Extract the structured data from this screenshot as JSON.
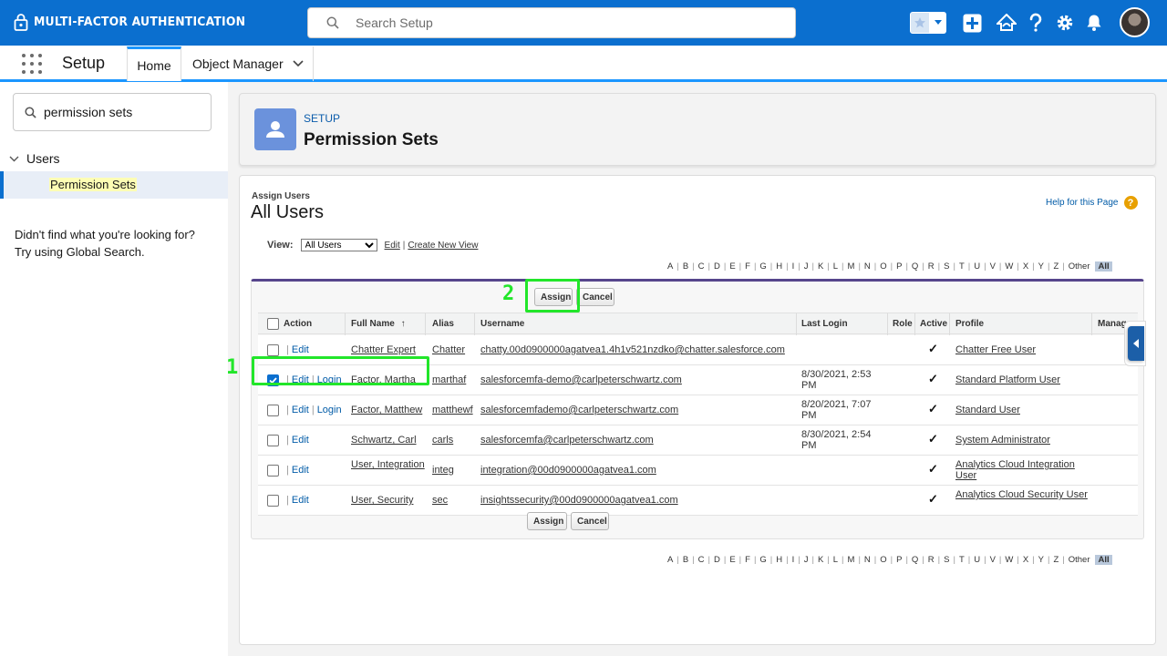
{
  "header": {
    "brand": "MULTI-FACTOR AUTHENTICATION",
    "search_placeholder": "Search Setup"
  },
  "nav": {
    "app_name": "Setup",
    "tabs": [
      {
        "label": "Home"
      },
      {
        "label": "Object Manager"
      }
    ]
  },
  "sidebar": {
    "search_value": "permission sets",
    "group": "Users",
    "selected_item": "Permission Sets",
    "help_line1": "Didn't find what you're looking for?",
    "help_line2": "Try using Global Search."
  },
  "page_header": {
    "breadcrumb": "SETUP",
    "title": "Permission Sets"
  },
  "content": {
    "subtitle": "Assign Users",
    "title": "All Users",
    "help_link": "Help for this Page",
    "view_label": "View:",
    "view_selected": "All Users",
    "view_edit": "Edit",
    "view_create": "Create New View",
    "alphabet": [
      "A",
      "B",
      "C",
      "D",
      "E",
      "F",
      "G",
      "H",
      "I",
      "J",
      "K",
      "L",
      "M",
      "N",
      "O",
      "P",
      "Q",
      "R",
      "S",
      "T",
      "U",
      "V",
      "W",
      "X",
      "Y",
      "Z",
      "Other",
      "All"
    ],
    "assign_label": "Assign",
    "cancel_label": "Cancel",
    "columns": [
      "Action",
      "Full Name",
      "Alias",
      "Username",
      "Last Login",
      "Role",
      "Active",
      "Profile",
      "Manager"
    ],
    "sort_indicator": "↑",
    "rows": [
      {
        "checked": false,
        "actions": "Edit",
        "login": "",
        "name": "Chatter Expert",
        "alias": "Chatter",
        "username": "chatty.00d0900000agatvea1.4h1v521nzdko@chatter.salesforce.com",
        "last_login": "",
        "active": true,
        "profile": "Chatter Free User"
      },
      {
        "checked": true,
        "actions": "Edit",
        "login": "Login",
        "name": "Factor, Martha",
        "alias": "marthaf",
        "username": "salesforcemfa-demo@carlpeterschwartz.com",
        "last_login": "8/30/2021, 2:53 PM",
        "active": true,
        "profile": "Standard Platform User"
      },
      {
        "checked": false,
        "actions": "Edit",
        "login": "Login",
        "name": "Factor, Matthew",
        "alias": "matthewf",
        "username": "salesforcemfademo@carlpeterschwartz.com",
        "last_login": "8/20/2021, 7:07 PM",
        "active": true,
        "profile": "Standard User"
      },
      {
        "checked": false,
        "actions": "Edit",
        "login": "",
        "name": "Schwartz, Carl",
        "alias": "carls",
        "username": "salesforcemfa@carlpeterschwartz.com",
        "last_login": "8/30/2021, 2:54 PM",
        "active": true,
        "profile": "System Administrator"
      },
      {
        "checked": false,
        "actions": "Edit",
        "login": "",
        "name": "User, Integration",
        "alias": "integ",
        "username": "integration@00d0900000agatvea1.com",
        "last_login": "",
        "active": true,
        "profile": "Analytics Cloud Integration User"
      },
      {
        "checked": false,
        "actions": "Edit",
        "login": "",
        "name": "User, Security",
        "alias": "sec",
        "username": "insightssecurity@00d0900000agatvea1.com",
        "last_login": "",
        "active": true,
        "profile": "Analytics Cloud Security User"
      }
    ]
  },
  "annotations": {
    "step1": "1",
    "step2": "2",
    "color": "#22e62a"
  },
  "colors": {
    "header_bg": "#0b6fcf",
    "accent": "#1b96ff",
    "list_border": "#56458c"
  }
}
